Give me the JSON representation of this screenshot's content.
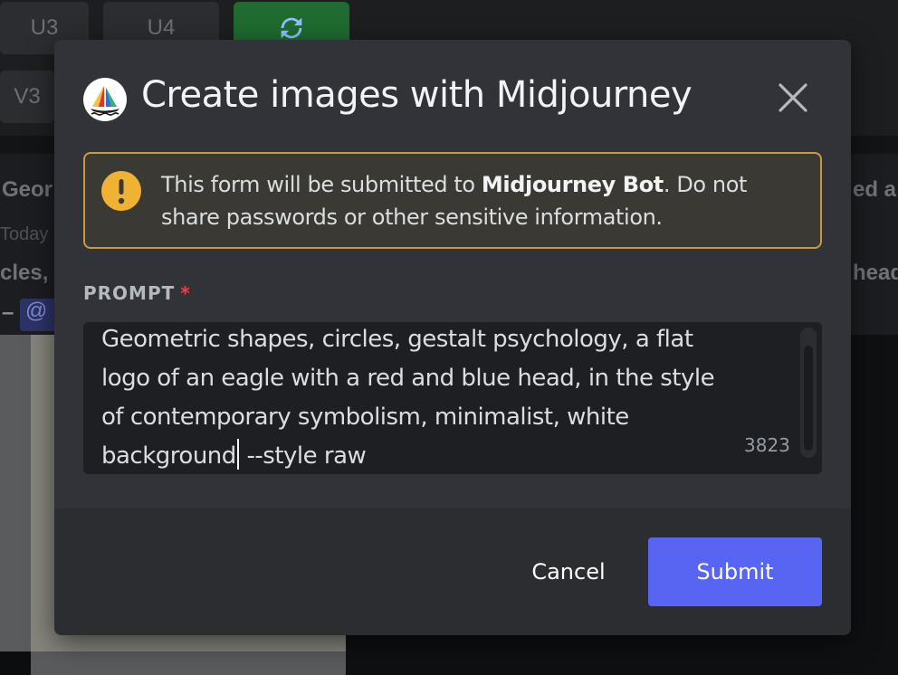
{
  "background": {
    "buttons_top": [
      "U3",
      "U4"
    ],
    "buttons_second": [
      "V3"
    ],
    "message_author_fragment": "Geor",
    "message_time_fragment": "Today",
    "message_text_fragment": "cles,",
    "message_dash": "–",
    "mention_fragment": "@",
    "right_text_1": "ed a",
    "right_text_2": "head"
  },
  "modal": {
    "title": "Create images with Midjourney",
    "avatar_icon": "midjourney-sailboat-icon",
    "close_icon": "close-icon"
  },
  "warning": {
    "icon": "exclamation-icon",
    "text_before": "This form will be submitted to ",
    "bot_name": "Midjourney Bot",
    "text_after": ". Do not share passwords or other sensitive information."
  },
  "prompt_field": {
    "label": "PROMPT",
    "required_mark": "*",
    "value_before_caret": "Geometric shapes, circles, gestalt psychology, a flat logo of an eagle with a red and blue head, in the style of contemporary symbolism, minimalist, white background",
    "value_after_caret": " --style raw",
    "remaining_chars": "3823"
  },
  "footer": {
    "cancel_label": "Cancel",
    "submit_label": "Submit"
  },
  "colors": {
    "modal_bg": "#313338",
    "footer_bg": "#2b2d31",
    "accent": "#5865f2",
    "warning_border": "#c99a3f",
    "warning_icon": "#f0b232",
    "required": "#f23f43"
  }
}
